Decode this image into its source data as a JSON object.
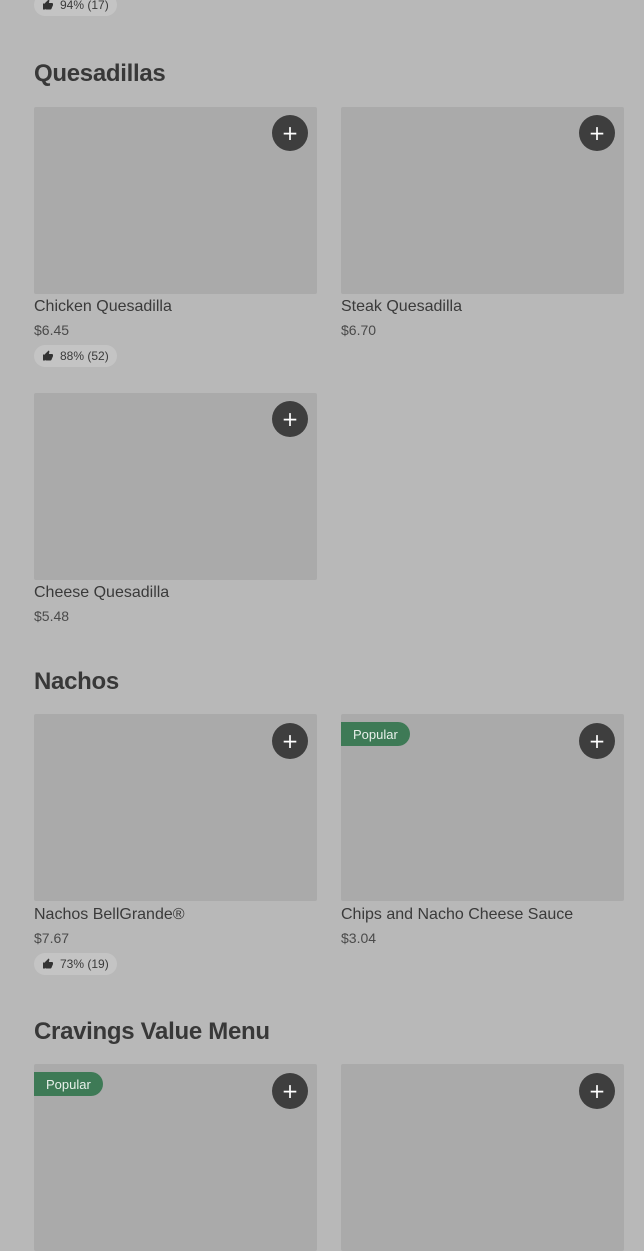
{
  "top_rating": {
    "text": "94% (17)"
  },
  "sections": [
    {
      "title": "Quesadillas",
      "items": [
        {
          "name": "Chicken Quesadilla",
          "price": "$6.45",
          "rating": "88% (52)"
        },
        {
          "name": "Steak Quesadilla",
          "price": "$6.70"
        },
        {
          "name": "Cheese Quesadilla",
          "price": "$5.48"
        }
      ]
    },
    {
      "title": "Nachos",
      "items": [
        {
          "name": "Nachos BellGrande®",
          "price": "$7.67",
          "rating": "73% (19)"
        },
        {
          "name": "Chips and Nacho Cheese Sauce",
          "price": "$3.04",
          "badge": "Popular"
        }
      ]
    },
    {
      "title": "Cravings Value Menu",
      "items": [
        {
          "badge": "Popular"
        }
      ]
    }
  ],
  "add_button_glyph": "+",
  "icons": {
    "add": "plus-icon",
    "rating": "thumbs-up-icon"
  },
  "colors": {
    "background": "#b8b8b8",
    "popular_badge": "#3e7a56",
    "add_button": "#3e3e3e"
  }
}
